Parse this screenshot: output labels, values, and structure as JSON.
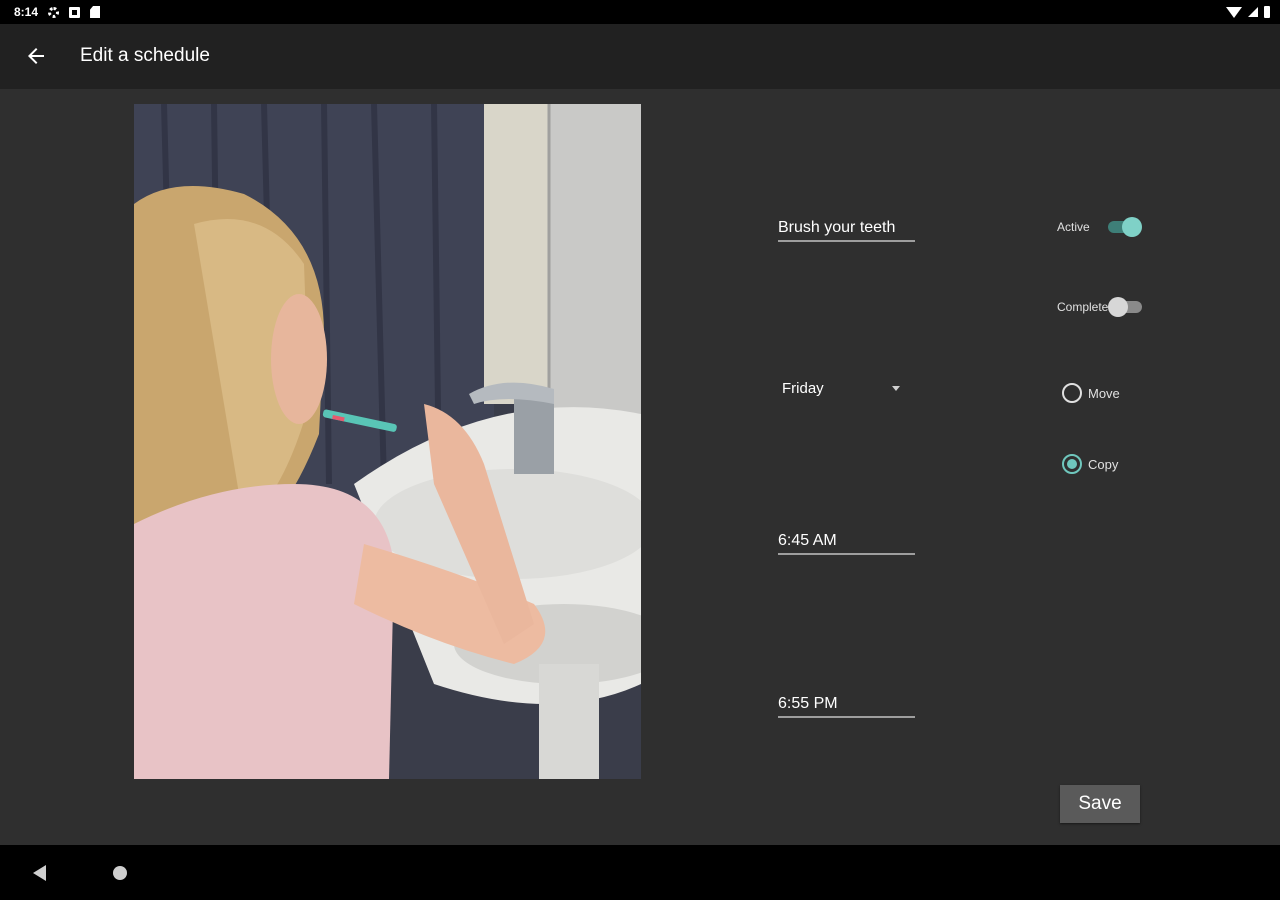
{
  "status_bar": {
    "time": "8:14",
    "left_icons": [
      "settings-icon",
      "notification-icon",
      "sd-card-icon"
    ],
    "right_icons": [
      "wifi-icon",
      "signal-icon",
      "battery-icon"
    ]
  },
  "app_bar": {
    "title": "Edit a schedule",
    "back_icon": "arrow-back-icon"
  },
  "schedule": {
    "task_name": "Brush your teeth",
    "day": "Friday",
    "start_time": "6:45 AM",
    "end_time": "6:55 PM"
  },
  "options": {
    "active_label": "Active",
    "active_on": true,
    "complete_label": "Complete",
    "complete_on": false,
    "move_label": "Move",
    "copy_label": "Copy",
    "selected_mode": "Copy"
  },
  "actions": {
    "save_label": "Save"
  },
  "nav_bar": {
    "icons": [
      "nav-back-icon",
      "nav-home-icon"
    ]
  },
  "colors": {
    "background": "#2f2f2f",
    "app_bar": "#212121",
    "accent": "#7fd1c7",
    "button": "#5a5a5a"
  }
}
